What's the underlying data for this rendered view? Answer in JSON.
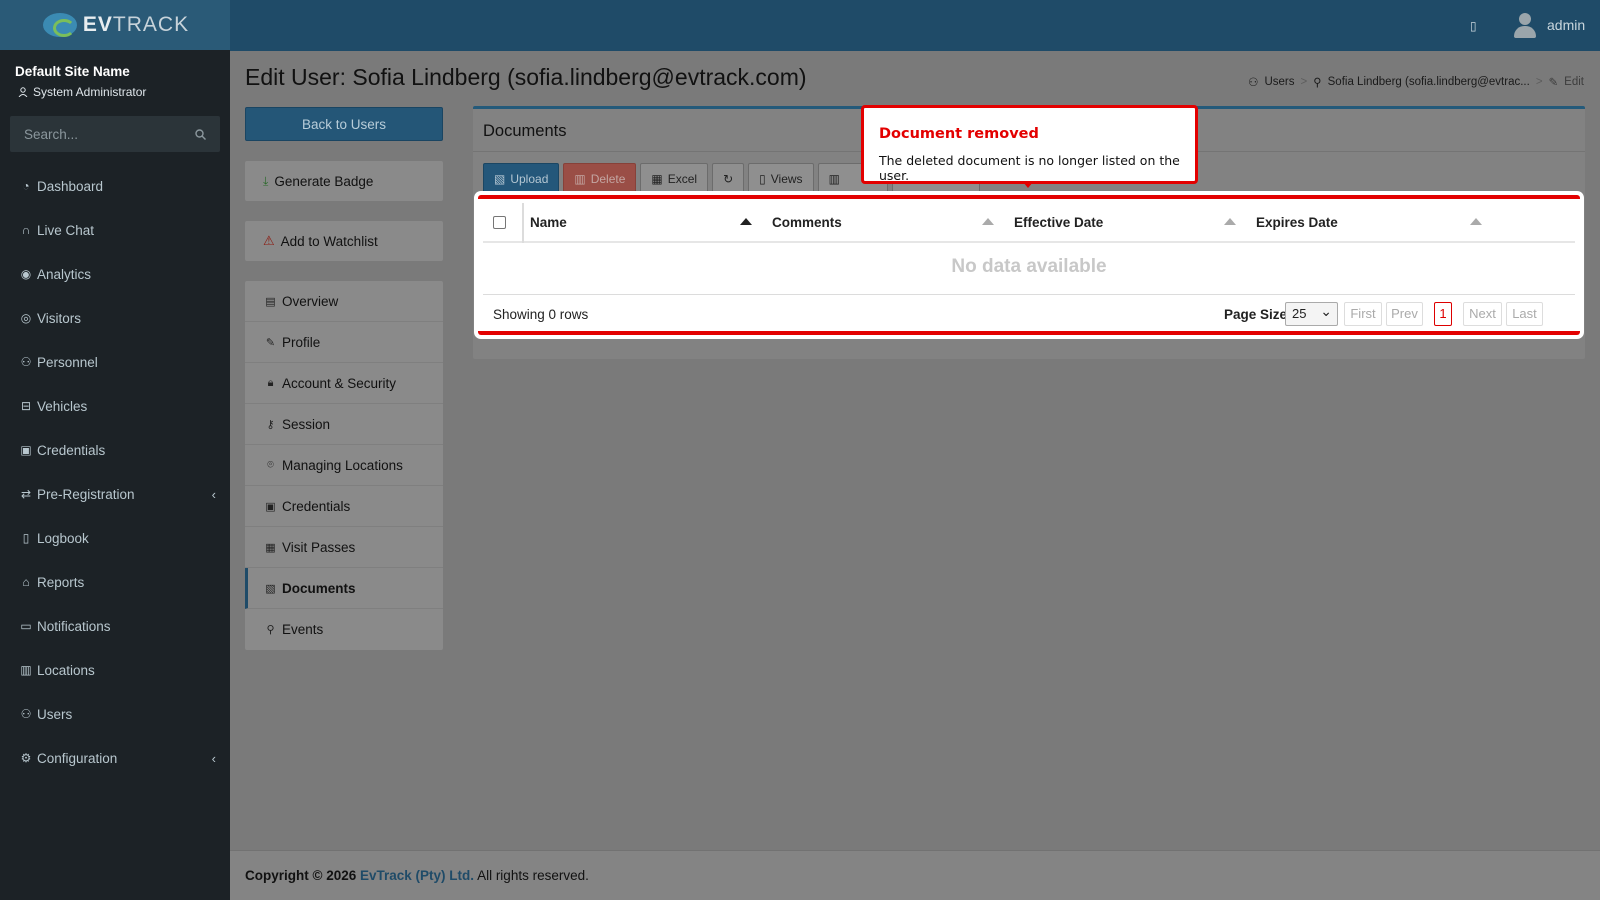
{
  "app": {
    "brand_bold": "EV",
    "brand_light": "TRACK"
  },
  "sidebar": {
    "site_name": "Default Site Name",
    "role": "System Administrator",
    "search_placeholder": "Search...",
    "items": [
      {
        "label": "Dashboard",
        "icon": "dashboard-icon"
      },
      {
        "label": "Live Chat",
        "icon": "headset-icon"
      },
      {
        "label": "Analytics",
        "icon": "analytics-icon"
      },
      {
        "label": "Visitors",
        "icon": "eye-icon"
      },
      {
        "label": "Personnel",
        "icon": "personnel-icon"
      },
      {
        "label": "Vehicles",
        "icon": "car-icon"
      },
      {
        "label": "Credentials",
        "icon": "id-badge-icon"
      },
      {
        "label": "Pre-Registration",
        "icon": "arrows-icon"
      },
      {
        "label": "Logbook",
        "icon": "book-icon"
      },
      {
        "label": "Reports",
        "icon": "chart-icon"
      },
      {
        "label": "Notifications",
        "icon": "chat-icon"
      },
      {
        "label": "Locations",
        "icon": "map-icon"
      },
      {
        "label": "Users",
        "icon": "users-icon"
      },
      {
        "label": "Configuration",
        "icon": "gear-icon"
      }
    ]
  },
  "topbar": {
    "username": "admin"
  },
  "page": {
    "title": "Edit User: Sofia Lindberg (sofia.lindberg@evtrack.com)",
    "breadcrumb": [
      "Users",
      "Sofia Lindberg (sofia.lindberg@evtrac...",
      "Edit"
    ]
  },
  "left": {
    "back_button": "Back to Users",
    "generate_badge": "Generate Badge",
    "add_watchlist": "Add to Watchlist",
    "nav": [
      "Overview",
      "Profile",
      "Account & Security",
      "Session",
      "Managing Locations",
      "Credentials",
      "Visit Passes",
      "Documents",
      "Events"
    ],
    "active": "Documents"
  },
  "documents": {
    "title": "Documents",
    "toolbar": {
      "upload": "Upload",
      "delete": "Delete",
      "excel": "Excel",
      "views": "Views"
    },
    "columns": [
      "Name",
      "Comments",
      "Effective Date",
      "Expires Date"
    ],
    "empty_text": "No data available",
    "showing": "Showing 0 rows",
    "page_size_label": "Page Size",
    "page_size": "25",
    "pager": {
      "first": "First",
      "prev": "Prev",
      "current": "1",
      "next": "Next",
      "last": "Last"
    }
  },
  "popup": {
    "title": "Document removed",
    "body": "The deleted document is no longer listed on the user."
  },
  "footer": {
    "prefix": "Copyright © 2026",
    "company": "EvTrack (Pty) Ltd.",
    "suffix": "All rights reserved."
  },
  "colors": {
    "accent": "#1f4b68",
    "highlight": "#e30000",
    "danger": "#9a4e46"
  }
}
